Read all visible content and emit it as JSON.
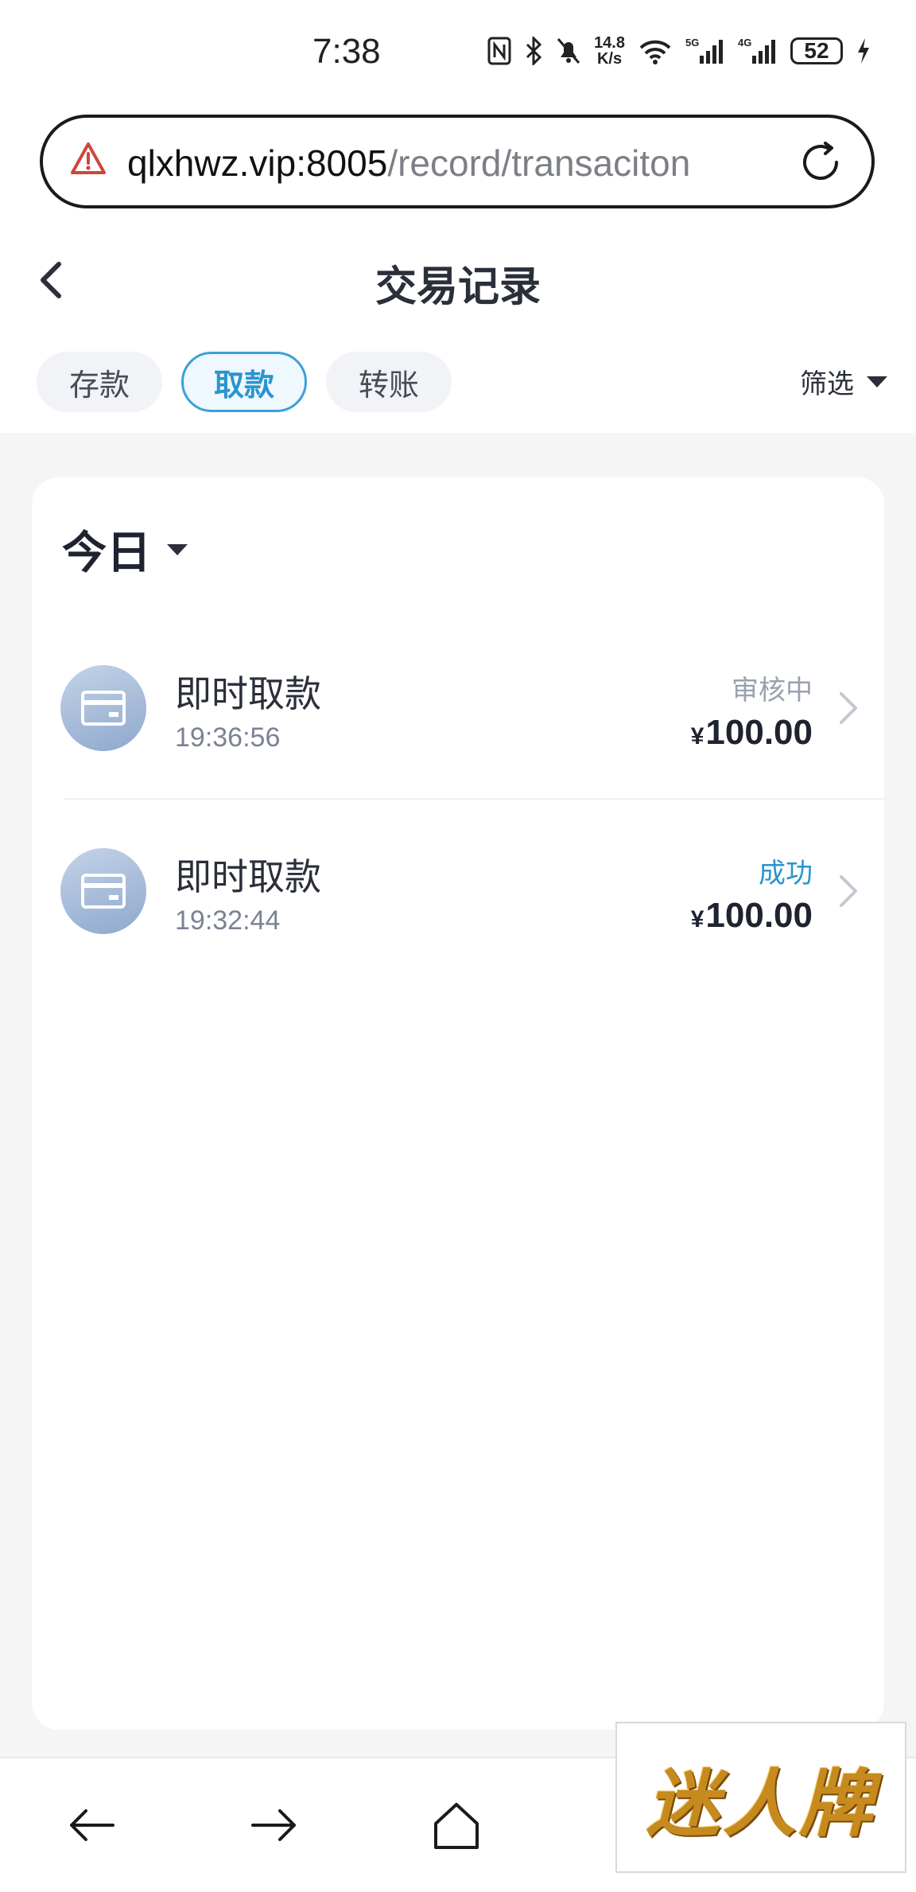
{
  "status_bar": {
    "time": "7:38",
    "net_speed_value": "14.8",
    "net_speed_unit": "K/s",
    "battery": "52",
    "signal1": "5G",
    "signal2": "4G"
  },
  "url_bar": {
    "host": "qlxhwz.vip:8005",
    "path": "/record/transaciton"
  },
  "header": {
    "title": "交易记录"
  },
  "tabs": [
    {
      "label": "存款",
      "active": false
    },
    {
      "label": "取款",
      "active": true
    },
    {
      "label": "转账",
      "active": false
    }
  ],
  "filter": {
    "label": "筛选"
  },
  "list": {
    "date_label": "今日",
    "items": [
      {
        "title": "即时取款",
        "time": "19:36:56",
        "status": "审核中",
        "currency": "¥",
        "amount": "100.00"
      },
      {
        "title": "即时取款",
        "time": "19:32:44",
        "status": "成功",
        "currency": "¥",
        "amount": "100.00"
      }
    ]
  },
  "colors": {
    "accent": "#2a94cf",
    "pending": "#9aa1ae",
    "background": "#f5f5f5"
  },
  "watermark": {
    "text": "迷人牌"
  }
}
